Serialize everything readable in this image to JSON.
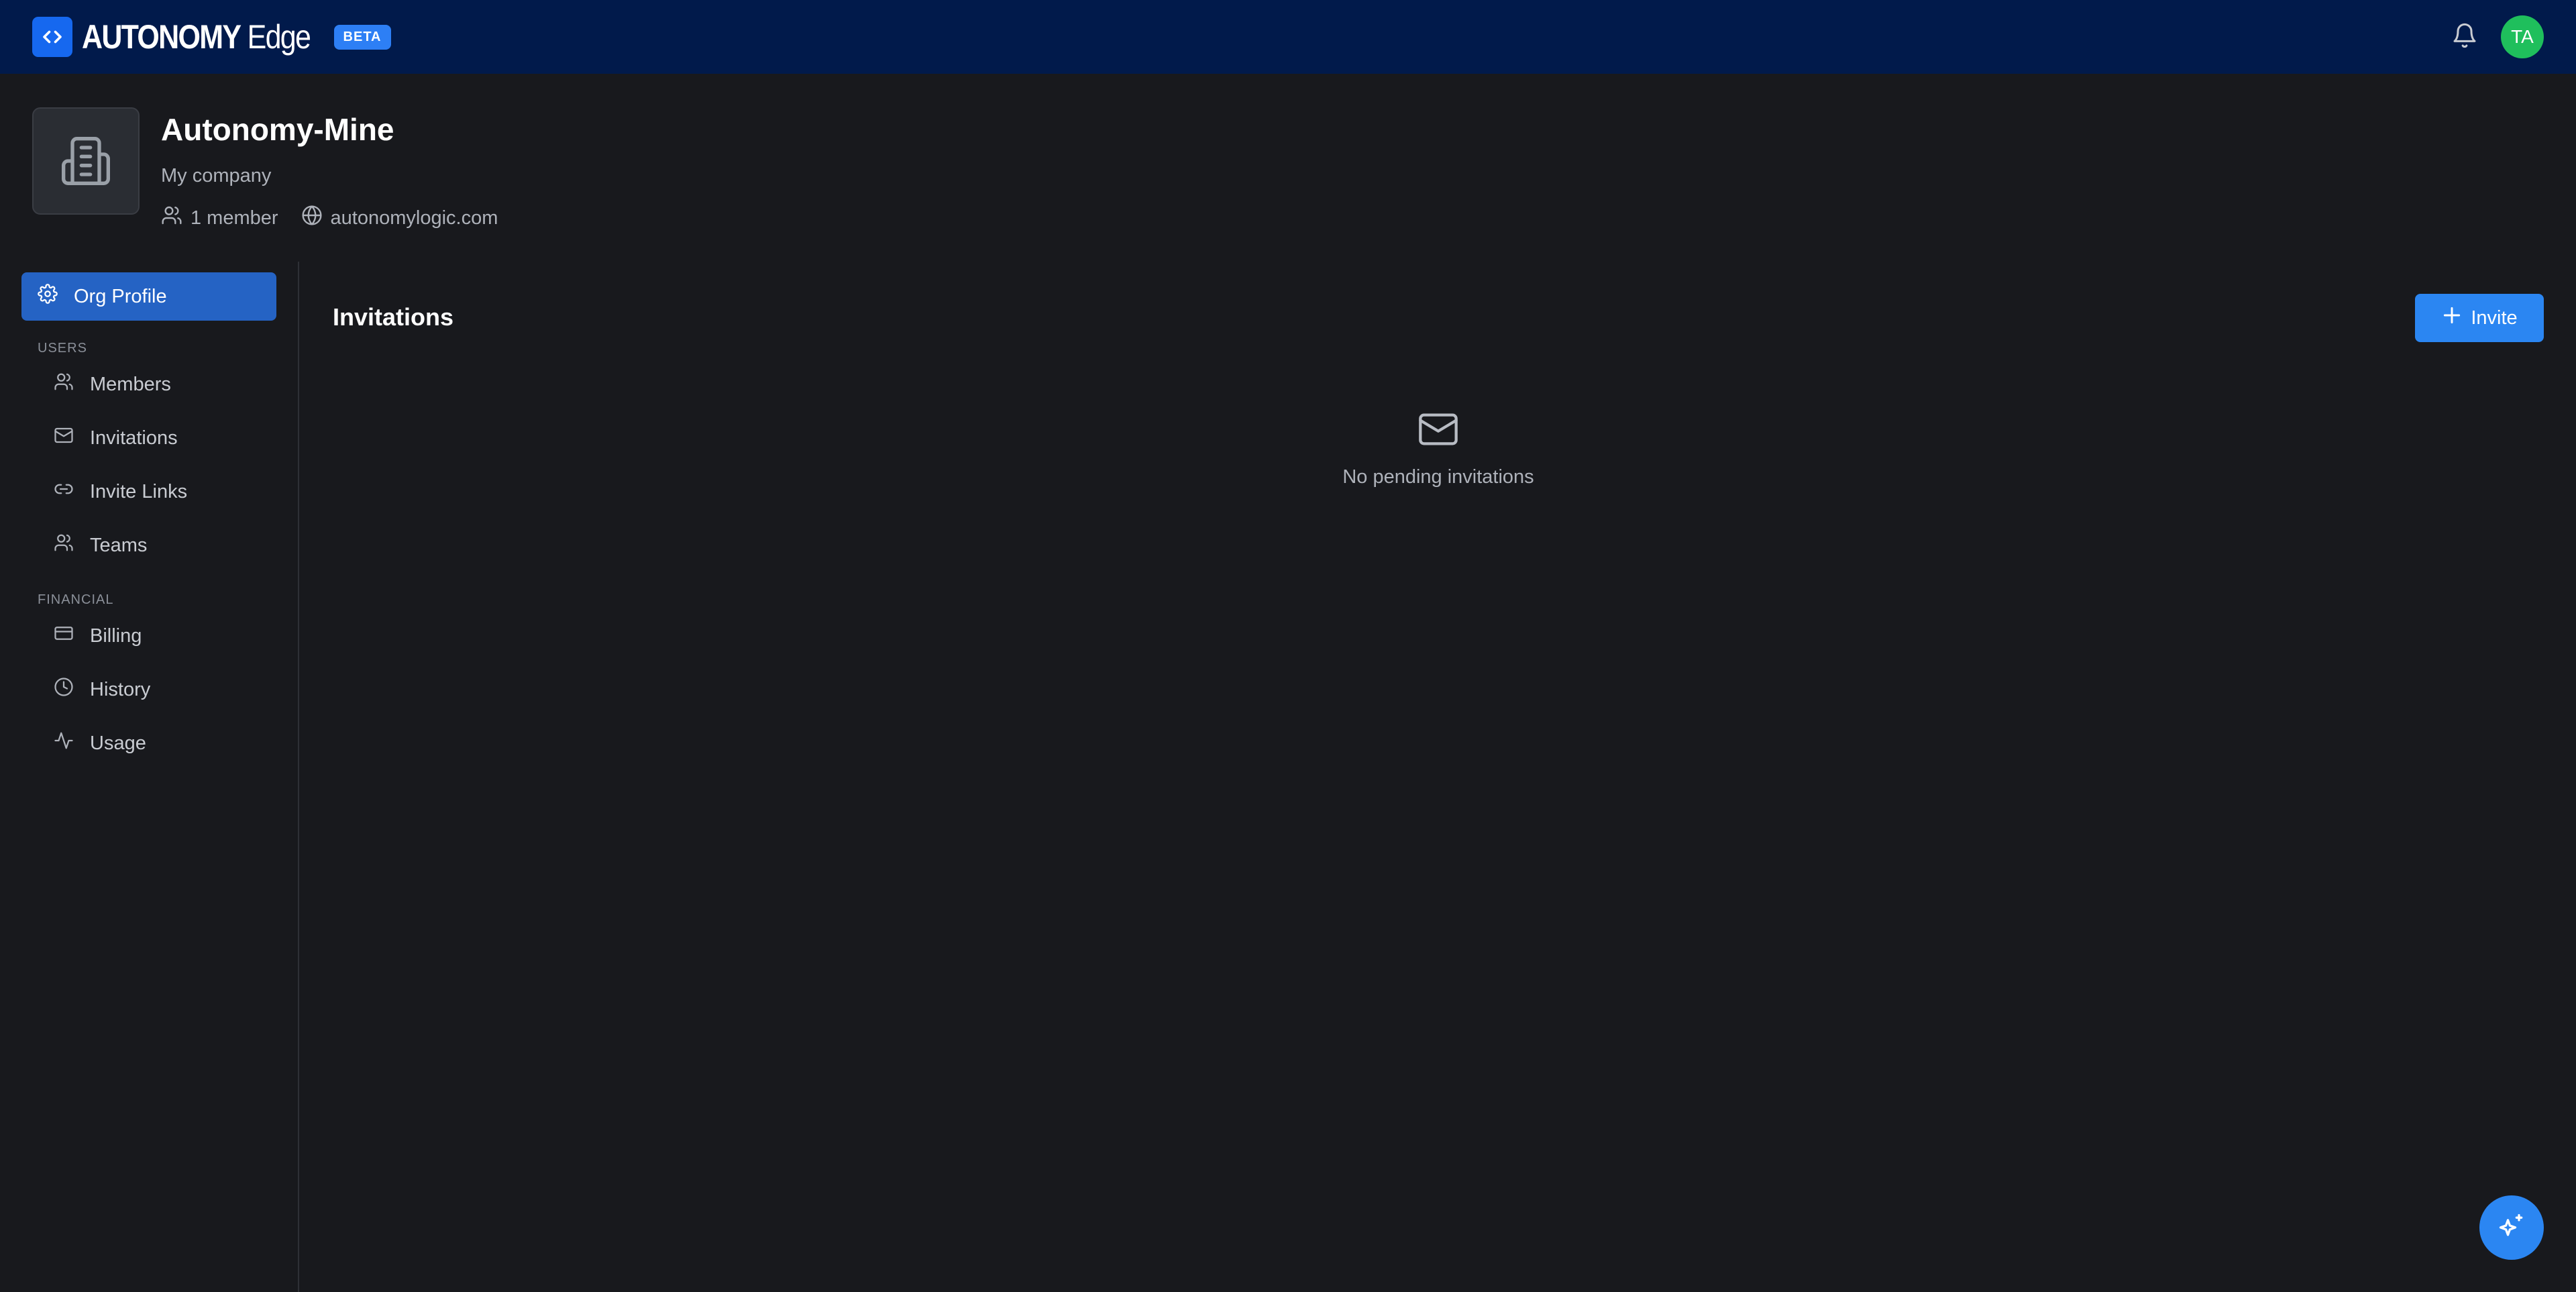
{
  "header": {
    "brand_bold": "AUTONOMY",
    "brand_light": "Edge",
    "badge": "BETA",
    "avatar_initials": "TA"
  },
  "org": {
    "name": "Autonomy-Mine",
    "description": "My company",
    "members": "1 member",
    "domain": "autonomylogic.com"
  },
  "sidebar": {
    "active_label": "Org Profile",
    "users_section": "USERS",
    "users_items": [
      "Members",
      "Invitations",
      "Invite Links",
      "Teams"
    ],
    "financial_section": "FINANCIAL",
    "financial_items": [
      "Billing",
      "History",
      "Usage"
    ]
  },
  "main": {
    "title": "Invitations",
    "invite_label": "Invite",
    "empty_text": "No pending invitations"
  },
  "colors": {
    "topbar": "#011a4b",
    "accent": "#2b86f2",
    "active_nav": "#2563c4",
    "avatar": "#1fbf5c",
    "background": "#18191d"
  }
}
